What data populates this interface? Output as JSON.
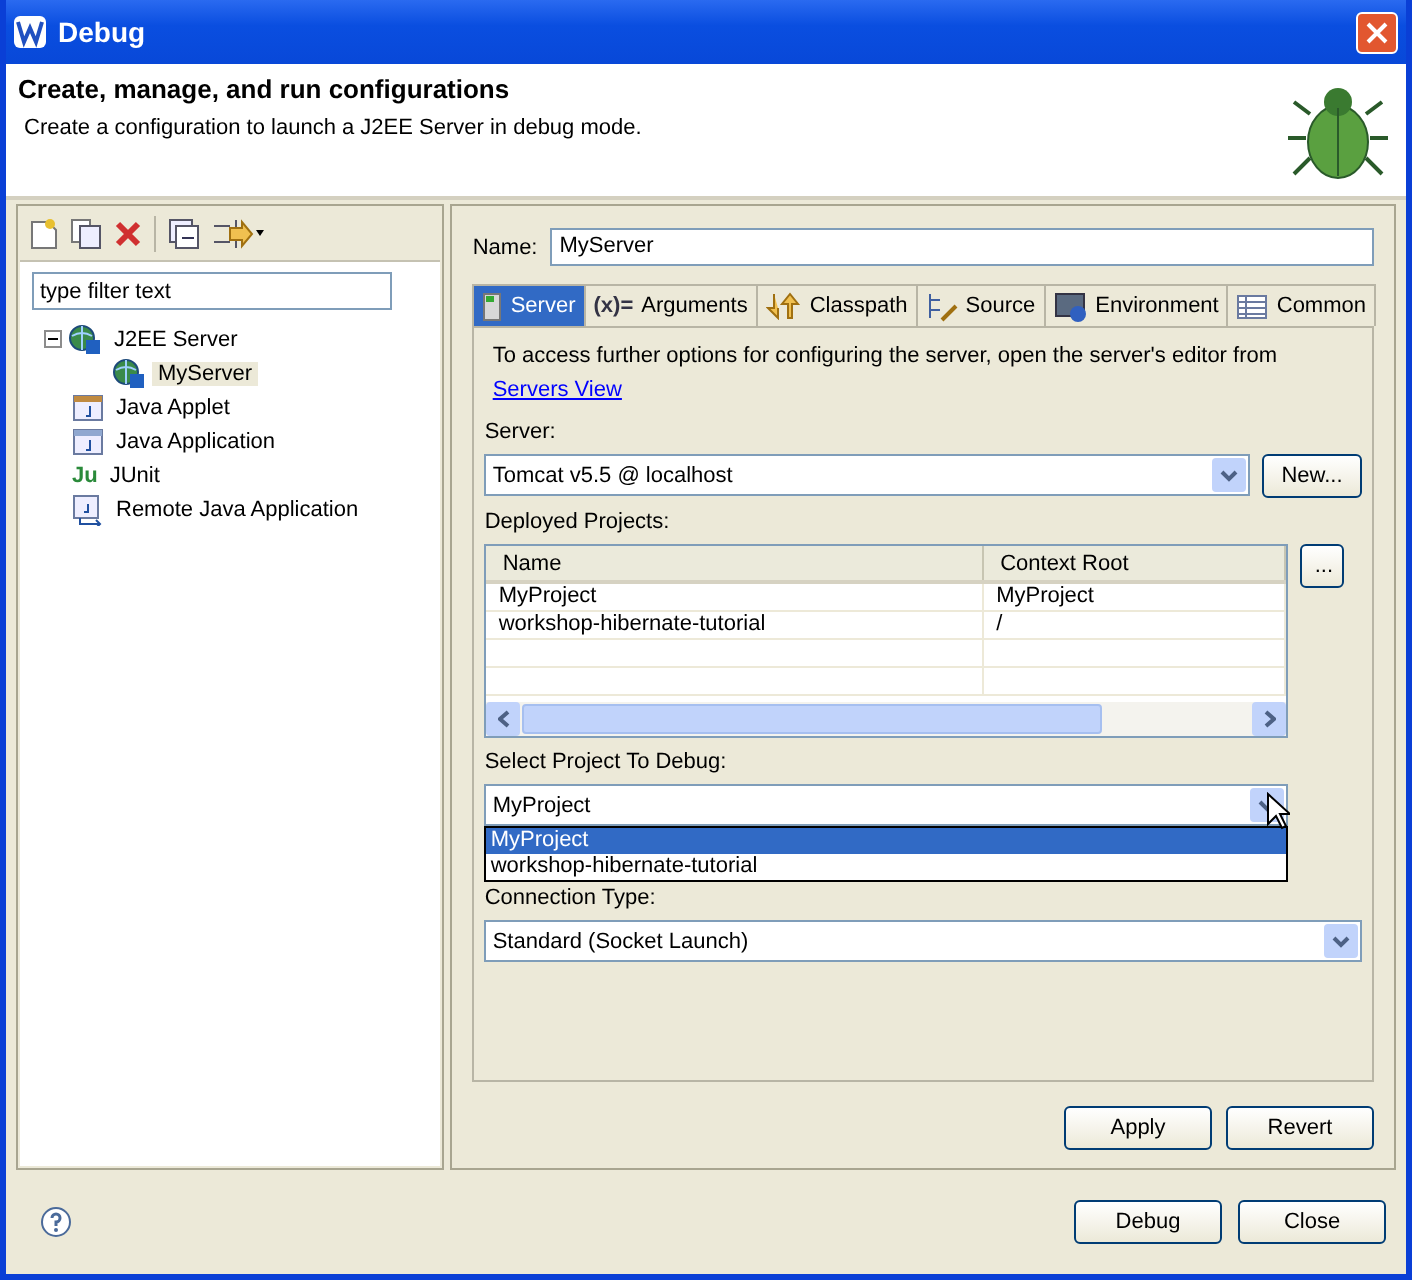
{
  "window": {
    "title": "Debug"
  },
  "header": {
    "title": "Create, manage, and run configurations",
    "description": "Create a configuration to launch a J2EE Server in debug mode."
  },
  "sidebar": {
    "filter": {
      "placeholder": "type filter text"
    },
    "tree": [
      {
        "label": "J2EE Server",
        "kind": "server",
        "expanded": true,
        "selected": false,
        "children": [
          {
            "label": "MyServer",
            "kind": "server",
            "selected": true
          }
        ]
      },
      {
        "label": "Java Applet",
        "kind": "applet",
        "selected": false
      },
      {
        "label": "Java Application",
        "kind": "application",
        "selected": false
      },
      {
        "label": "JUnit",
        "kind": "junit",
        "glyph": "Ju",
        "selected": false
      },
      {
        "label": "Remote Java Application",
        "kind": "remote",
        "selected": false
      }
    ]
  },
  "name": {
    "label": "Name:",
    "value": "MyServer"
  },
  "tabs": [
    {
      "label": "Server",
      "kind": "server",
      "selected": true
    },
    {
      "label": "Arguments",
      "kind": "variables",
      "glyph": "(x)=",
      "selected": false
    },
    {
      "label": "Classpath",
      "kind": "classpath",
      "selected": false
    },
    {
      "label": "Source",
      "kind": "source",
      "selected": false
    },
    {
      "label": "Environment",
      "kind": "environment",
      "selected": false
    },
    {
      "label": "Common",
      "kind": "common",
      "selected": false
    }
  ],
  "server_tab": {
    "info": "To access further options for configuring the server, open the server's editor from",
    "link": "Servers View",
    "server": {
      "label": "Server:",
      "value": "Tomcat v5.5 @ localhost",
      "button": "New..."
    },
    "projects": {
      "label": "Deployed Projects:",
      "columns": [
        "Name",
        "Context Root"
      ],
      "button": "...",
      "rows": [
        [
          "MyProject",
          "MyProject"
        ],
        [
          "workshop-hibernate-tutorial",
          "/"
        ]
      ]
    },
    "debug_project": {
      "label": "Select Project To Debug:",
      "value": "MyProject",
      "open": true,
      "options": [
        {
          "label": "MyProject",
          "selected": true
        },
        {
          "label": "workshop-hibernate-tutorial",
          "selected": false
        }
      ]
    },
    "connection": {
      "label": "Connection Type:",
      "value": "Standard (Socket Launch)"
    }
  },
  "panel_buttons": [
    "Apply",
    "Revert"
  ],
  "dialog_buttons": [
    "Debug",
    "Close"
  ]
}
